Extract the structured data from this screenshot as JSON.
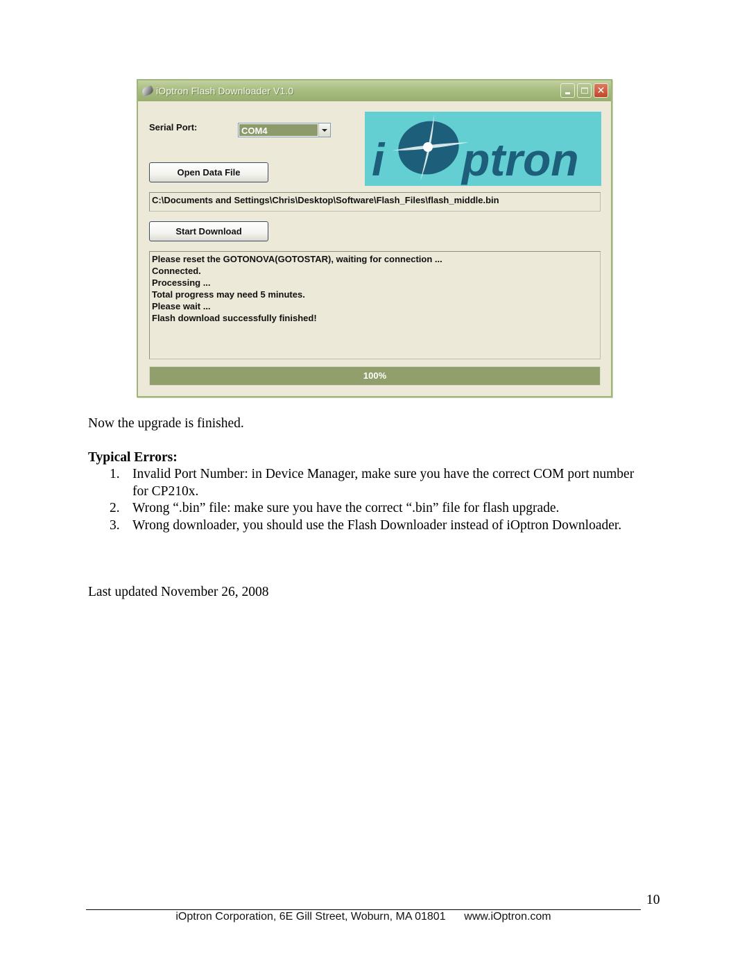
{
  "window": {
    "title": "iOptron Flash Downloader V1.0",
    "controls": {
      "minimize": "minimize",
      "maximize": "maximize",
      "close": "✕"
    },
    "serial_port_label": "Serial Port:",
    "serial_port_value": "COM4",
    "open_button": "Open Data File",
    "file_path": "C:\\Documents and Settings\\Chris\\Desktop\\Software\\Flash_Files\\flash_middle.bin",
    "start_button": "Start Download",
    "log_lines": [
      "Please reset the GOTONOVA(GOTOSTAR), waiting for connection ...",
      "Connected.",
      "Processing ...",
      "Total progress may need 5 minutes.",
      "Please wait ...",
      "Flash download successfully finished!"
    ],
    "progress_percent": 100,
    "progress_label": "100%",
    "logo_text": "ptron",
    "colors": {
      "dialog_bg": "#ece9d8",
      "titlebar": "#a9bd82",
      "progress_fill": "#919f6c",
      "logo_bg": "#63cfd3",
      "logo_fg": "#1d5f7a"
    }
  },
  "document": {
    "finished_text": "Now the upgrade is finished.",
    "errors_heading": "Typical Errors:",
    "errors": [
      {
        "num": "1.",
        "text": "Invalid Port Number: in Device Manager, make sure you have the correct COM port number for CP210x."
      },
      {
        "num": "2.",
        "text": "Wrong “.bin” file: make sure you have the correct “.bin” file for flash upgrade."
      },
      {
        "num": "3.",
        "text": "Wrong downloader, you should use the Flash Downloader instead of iOptron Downloader."
      }
    ],
    "last_updated": "Last updated November 26, 2008"
  },
  "footer": {
    "page_number": "10",
    "text": "iOptron Corporation, 6E Gill Street, Woburn, MA 01801      www.iOptron.com"
  }
}
